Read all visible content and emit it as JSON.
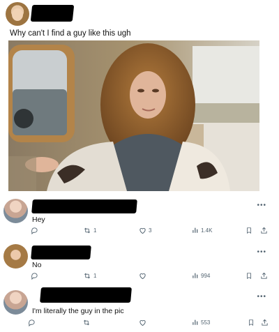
{
  "post": {
    "caption": "Why can't I find a guy like this ugh"
  },
  "replies": [
    {
      "text": "Hey",
      "replies": "",
      "retweets": "1",
      "likes": "3",
      "views": "1.4K"
    },
    {
      "text": "No",
      "replies": "",
      "retweets": "1",
      "likes": "",
      "views": "994"
    },
    {
      "text": "I'm literally the guy in the pic",
      "replies": "",
      "retweets": "",
      "likes": "",
      "views": "553"
    }
  ],
  "icons": [
    "avatar",
    "more-icon",
    "reply-icon",
    "retweet-icon",
    "like-icon",
    "views-icon",
    "bookmark-icon",
    "share-icon"
  ],
  "colors": {
    "icon_gray": "#536471",
    "text": "#0f1419",
    "background": "#ffffff"
  }
}
